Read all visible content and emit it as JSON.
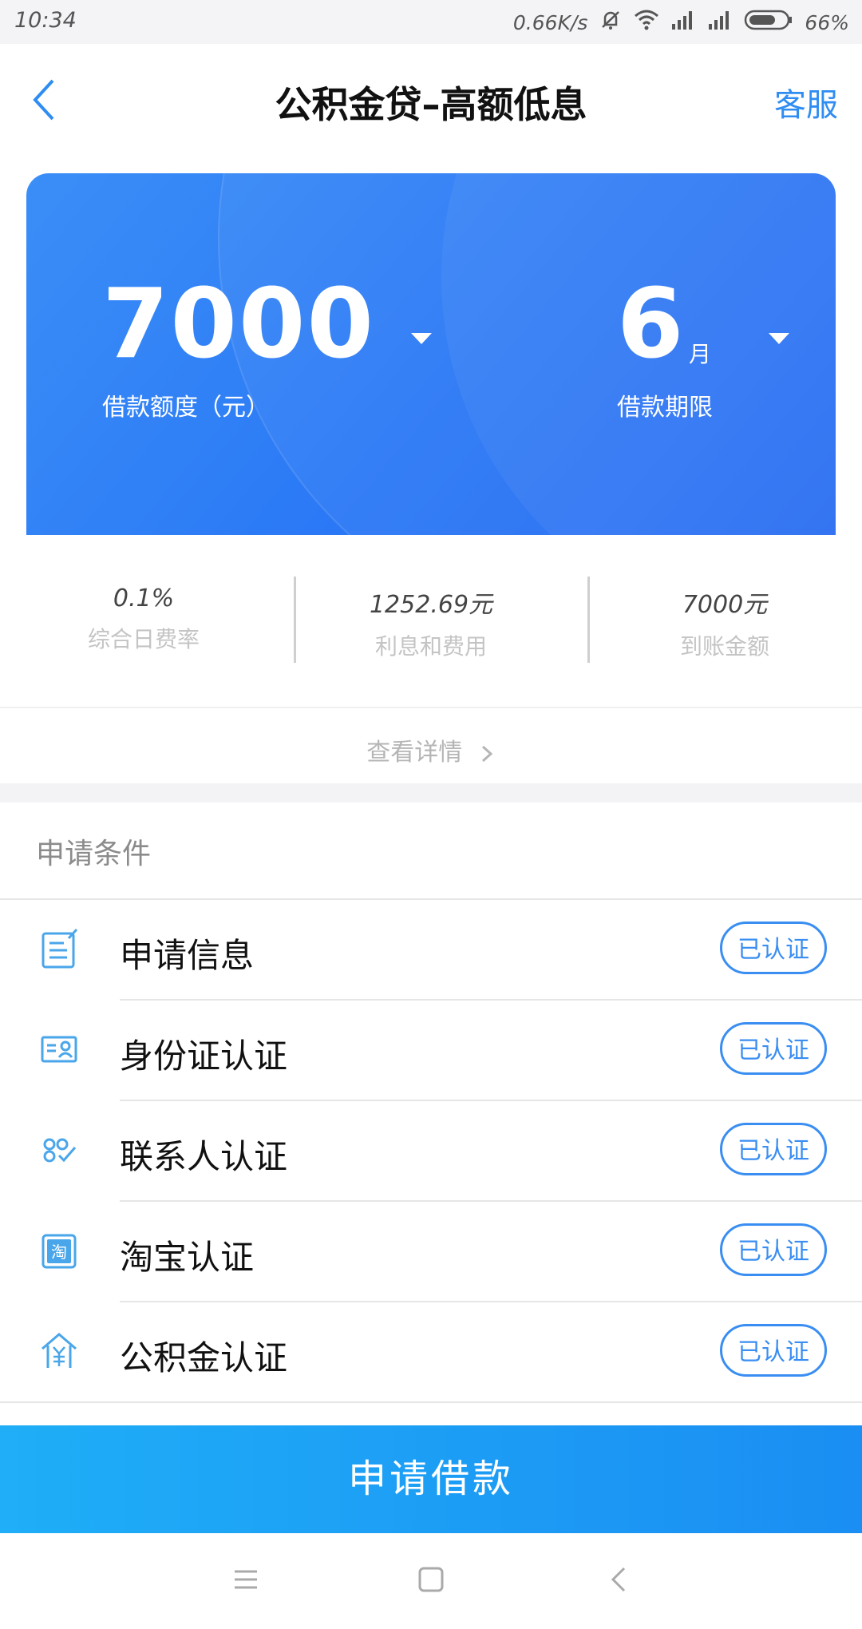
{
  "status_bar": {
    "time": "10:34",
    "speed": "0.66K/s",
    "battery": "66%",
    "icons": [
      "mute-icon",
      "wifi-icon",
      "signal-icon",
      "signal-icon",
      "battery-icon"
    ]
  },
  "header": {
    "title": "公积金贷–高额低息",
    "service": "客服",
    "back_icon": "chevron-left-icon"
  },
  "loan_card": {
    "amount": "7000",
    "amount_label": "借款额度（元）",
    "term": "6",
    "term_unit": "月",
    "term_label": "借款期限"
  },
  "stats": [
    {
      "value": "0.1%",
      "label": "综合日费率"
    },
    {
      "value": "1252.69元",
      "label": "利息和费用"
    },
    {
      "value": "7000元",
      "label": "到账金额"
    }
  ],
  "details_link": "查看详情",
  "conditions": {
    "title": "申请条件",
    "items": [
      {
        "label": "申请信息",
        "status": "已认证",
        "icon": "form-icon"
      },
      {
        "label": "身份证认证",
        "status": "已认证",
        "icon": "id-card-icon"
      },
      {
        "label": "联系人认证",
        "status": "已认证",
        "icon": "contacts-icon"
      },
      {
        "label": "淘宝认证",
        "status": "已认证",
        "icon": "taobao-icon"
      },
      {
        "label": "公积金认证",
        "status": "已认证",
        "icon": "housing-fund-icon"
      }
    ]
  },
  "apply_button": "申请借款",
  "colors": {
    "accent": "#2f8df2",
    "card_blue": "#2d7cf6",
    "button_blue": "#1a9cf5"
  }
}
